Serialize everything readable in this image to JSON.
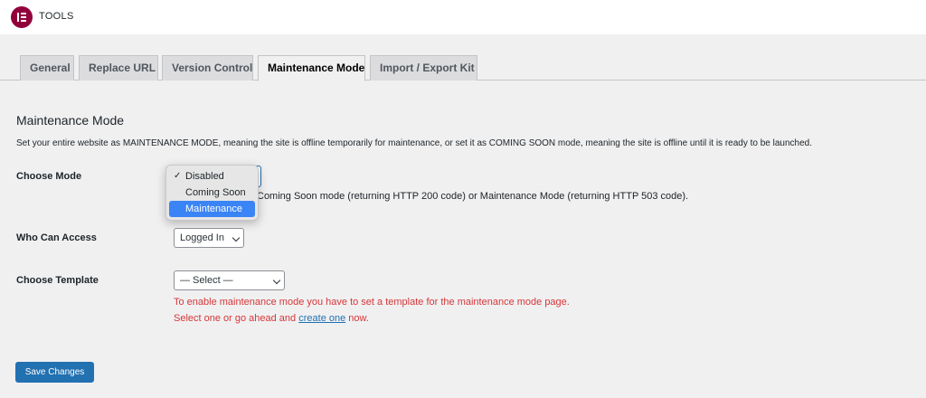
{
  "topbar": {
    "title": "TOOLS",
    "logo_icon": "elementor-logo-icon"
  },
  "tabs": [
    {
      "label": "General"
    },
    {
      "label": "Replace URL"
    },
    {
      "label": "Version Control"
    },
    {
      "label": "Maintenance Mode",
      "active": true
    },
    {
      "label": "Import / Export Kit"
    }
  ],
  "main": {
    "title": "Maintenance Mode",
    "description": "Set your entire website as MAINTENANCE MODE, meaning the site is offline temporarily for maintenance, or set it as COMING SOON mode, meaning the site is offline until it is ready to be launched."
  },
  "choose_mode": {
    "label": "Choose Mode",
    "description_visible": "Coming Soon mode (returning HTTP 200 code) or Maintenance Mode (returning HTTP 503 code).",
    "dropdown_options": [
      {
        "label": "Disabled",
        "checked": true
      },
      {
        "label": "Coming Soon"
      },
      {
        "label": "Maintenance",
        "highlighted": true
      }
    ],
    "check_mark": "✓"
  },
  "who_can_access": {
    "label": "Who Can Access",
    "value": "Logged In"
  },
  "choose_template": {
    "label": "Choose Template",
    "value": "— Select —",
    "warning_line1": "To enable maintenance mode you have to set a template for the maintenance mode page.",
    "warning_line2_prefix": "Select one or go ahead and",
    "warning_link": "create one",
    "warning_line2_suffix": "now."
  },
  "save_button": {
    "label": "Save Changes"
  },
  "colors": {
    "accent": "#2271b1",
    "brand": "#92003b",
    "error": "#d63638",
    "highlight": "#3a84f5"
  }
}
